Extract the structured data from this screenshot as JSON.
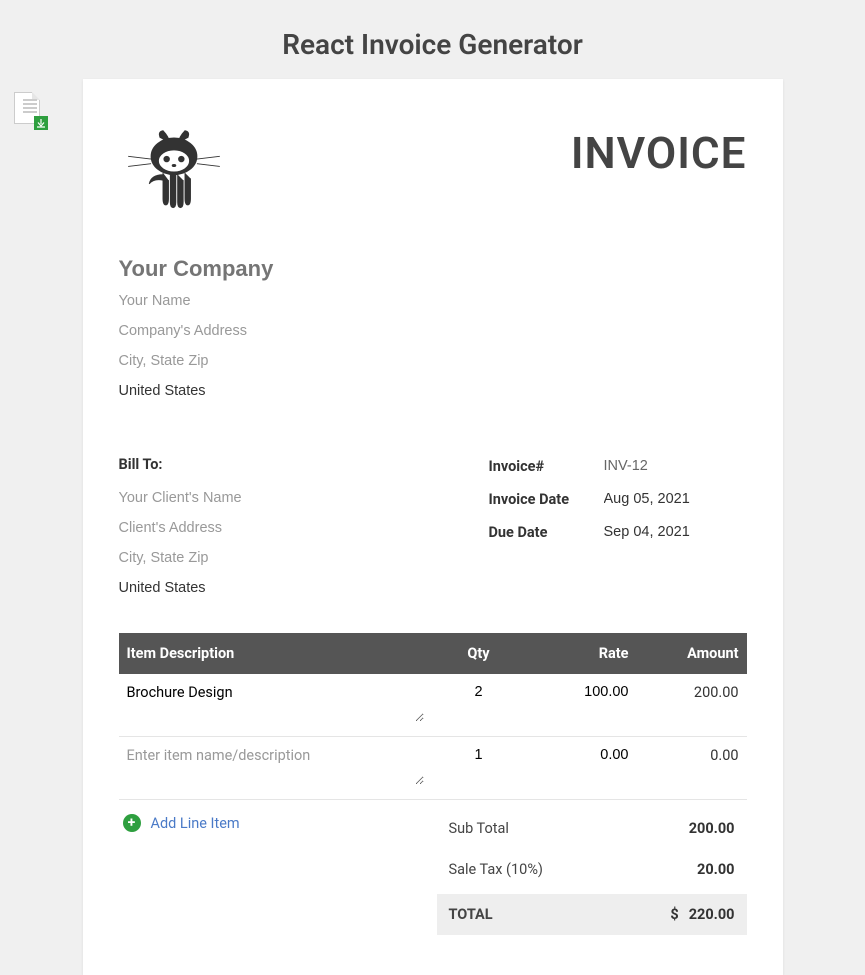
{
  "pageTitle": "React Invoice Generator",
  "invoiceTitle": "INVOICE",
  "company": {
    "namePlaceholder": "Your Company",
    "namePlaceholder2": "Your Name",
    "addressPlaceholder": "Company's Address",
    "cityPlaceholder": "City, State Zip",
    "country": "United States"
  },
  "billTo": {
    "label": "Bill To:",
    "clientNamePlaceholder": "Your Client's Name",
    "clientAddressPlaceholder": "Client's Address",
    "clientCityPlaceholder": "City, State Zip",
    "clientCountry": "United States"
  },
  "meta": {
    "invoiceNumLabel": "Invoice#",
    "invoiceNum": "INV-12",
    "invoiceDateLabel": "Invoice Date",
    "invoiceDate": "Aug 05, 2021",
    "dueDateLabel": "Due Date",
    "dueDate": "Sep 04, 2021"
  },
  "columns": {
    "desc": "Item Description",
    "qty": "Qty",
    "rate": "Rate",
    "amount": "Amount"
  },
  "items": [
    {
      "desc": "Brochure Design",
      "descPlaceholder": "Enter item name/description",
      "qty": "2",
      "rate": "100.00",
      "amount": "200.00"
    },
    {
      "desc": "",
      "descPlaceholder": "Enter item name/description",
      "qty": "1",
      "rate": "0.00",
      "amount": "0.00"
    }
  ],
  "addLineLabel": "Add Line Item",
  "totals": {
    "subTotalLabel": "Sub Total",
    "subTotal": "200.00",
    "taxLabel": "Sale Tax (10%)",
    "tax": "20.00",
    "totalLabel": "TOTAL",
    "currency": "$",
    "total": "220.00"
  }
}
